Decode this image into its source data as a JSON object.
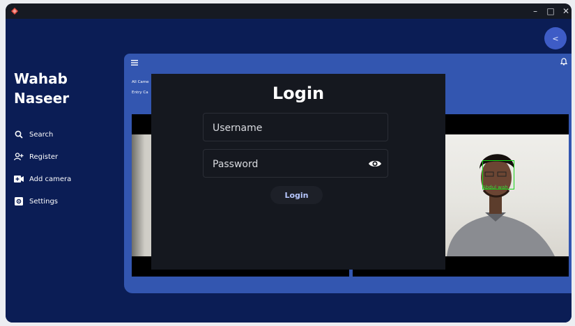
{
  "colors": {
    "window_bg": "#0b1d55",
    "panel_bg": "#3356b0",
    "dialog_bg": "#15181f",
    "accent": "#3e5cc6",
    "face_box": "#18d418"
  },
  "titlebar": {
    "app_icon": "app-logo-icon",
    "minimize": "–",
    "maximize": "□",
    "close": "✕"
  },
  "top_button": {
    "label": "<",
    "icon": "back-icon"
  },
  "sidebar": {
    "user_first": "Wahab",
    "user_last": "Naseer",
    "items": [
      {
        "label": "Search",
        "icon": "search-icon"
      },
      {
        "label": "Register",
        "icon": "person-add-icon"
      },
      {
        "label": "Add camera",
        "icon": "video-camera-add-icon"
      },
      {
        "label": "Settings",
        "icon": "settings-icon"
      }
    ]
  },
  "main": {
    "menu_icon": "hamburger-menu-icon",
    "notification_icon": "bell-icon",
    "camera_labels": [
      "All Came",
      "Entry Ca"
    ],
    "face_label": "Abdul wah"
  },
  "login": {
    "title": "Login",
    "username_placeholder": "Username",
    "password_placeholder": "Password",
    "eye_icon": "eye-icon",
    "button": "Login"
  }
}
